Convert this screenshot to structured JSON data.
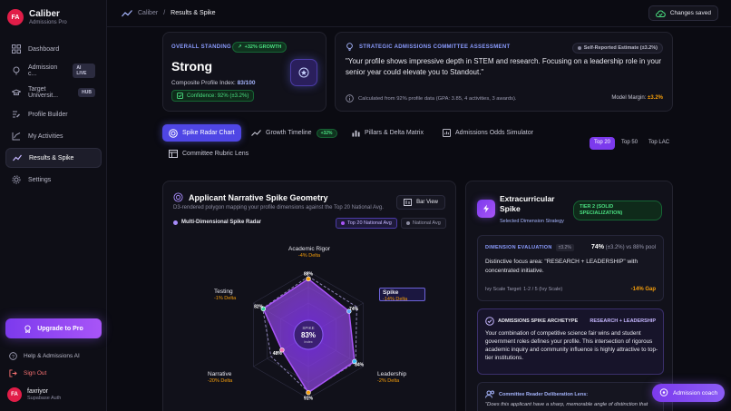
{
  "brand": {
    "initials": "FA",
    "name": "Caliber",
    "sub": "Admissions Pro"
  },
  "nav": [
    {
      "label": "Dashboard",
      "icon": "grid-icon",
      "active": false,
      "badge": ""
    },
    {
      "label": "Admission c...",
      "icon": "pin-icon",
      "active": false,
      "badge": "AI LIVE"
    },
    {
      "label": "Target Universit...",
      "icon": "graduation-cap-icon",
      "active": false,
      "badge": "HUB"
    },
    {
      "label": "Profile Builder",
      "icon": "edit-icon",
      "active": false,
      "badge": ""
    },
    {
      "label": "My Activities",
      "icon": "activity-icon",
      "active": false,
      "badge": ""
    },
    {
      "label": "Results & Spike",
      "icon": "trend-icon",
      "active": true,
      "badge": ""
    },
    {
      "label": "Settings",
      "icon": "gear-icon",
      "active": false,
      "badge": ""
    }
  ],
  "upgrade": "Upgrade to Pro",
  "help": "Help & Admissions AI",
  "signout": "Sign Out",
  "user": {
    "initials": "FA",
    "name": "faxriyor",
    "sub": "Supabase Auth"
  },
  "topbar": {
    "root": "Caliber",
    "sep": "/",
    "current": "Results & Spike",
    "saved": "Changes saved"
  },
  "standing": {
    "label": "OVERALL STANDING",
    "growth": "+32% GROWTH",
    "value": "Strong",
    "index_label": "Composite Profile Index:",
    "index_value": "83/100",
    "confidence": "Confidence: 92% (±3.2%)"
  },
  "committee": {
    "label": "STRATEGIC ADMISSIONS COMMITTEE ASSESSMENT",
    "badge": "Self-Reported Estimate (±3.2%)",
    "quote": "\"Your profile shows impressive depth in STEM and research. Focusing on a leadership role in your senior year could elevate you to Standout.\"",
    "calc": "Calculated from 92% profile data (GPA: 3.85, 4 activities, 3 awards).",
    "margin_label": "Model Margin:",
    "margin_value": "±3.2%"
  },
  "tabs": [
    {
      "label": "Spike Radar Chart",
      "icon": "radar-icon",
      "active": true,
      "badge": ""
    },
    {
      "label": "Growth Timeline",
      "icon": "trend-icon",
      "active": false,
      "badge": "+32%"
    },
    {
      "label": "Pillars & Delta Matrix",
      "icon": "bars-icon",
      "active": false,
      "badge": ""
    },
    {
      "label": "Admissions Odds Simulator",
      "icon": "chart-icon",
      "active": false,
      "badge": ""
    },
    {
      "label": "Committee Rubric Lens",
      "icon": "table-icon",
      "active": false,
      "badge": ""
    }
  ],
  "segments": [
    "Top 20",
    "Top 50",
    "Top LAC"
  ],
  "radar": {
    "title": "Applicant Narrative Spike Geometry",
    "subtitle": "D3-rendered polygon mapping your profile dimensions against the Top 20 National Avg.",
    "bar_view": "Bar View",
    "multi": "Multi-Dimensional Spike Radar",
    "legend_you": "Top 20 National Avg",
    "legend_avg": "National Avg",
    "center_label": "SPIKE",
    "center_value": "83%",
    "center_sub": "Index"
  },
  "chart_data": {
    "type": "radar",
    "axes": [
      "Academic Rigor",
      "Spike",
      "Leadership",
      "Community",
      "Narrative",
      "Testing"
    ],
    "values": [
      88,
      74,
      84,
      91,
      48,
      82
    ],
    "value_labels": [
      "88%",
      "74%",
      "84%",
      "91%",
      "48%",
      "82%"
    ],
    "deltas": [
      "-4% Delta",
      "-14% Delta",
      "-2% Delta",
      "",
      "-20% Delta",
      "-1% Delta"
    ],
    "benchmark": [
      92,
      88,
      86,
      90,
      68,
      83
    ],
    "range": [
      0,
      100
    ],
    "colors": {
      "you": "#a855f7",
      "benchmark": "#8b8ba0",
      "accent": "#f59e0b"
    }
  },
  "extra": {
    "title": "Extracurricular Spike",
    "tier": "TIER 2 (SOLID SPECIALIZATION)",
    "sub": "Selected Dimension Strategy",
    "eval_label": "DIMENSION EVALUATION",
    "eval_tag": "±3.2%",
    "eval_value": "74%",
    "eval_rest": "(±3.2%) vs 88% pool",
    "focus": "Distinctive focus area: \"RESEARCH + LEADERSHIP\" with concentrated initiative.",
    "ivy": "Ivy Scale Target: 1-2 / 5 (Ivy Scale)",
    "gap": "-14% Gap",
    "arch_label": "ADMISSIONS SPIKE ARCHETYPE",
    "arch_value": "RESEARCH + LEADERSHIP",
    "arch_text": "Your combination of competitive science fair wins and student government roles defines your profile. This intersection of rigorous academic inquiry and community influence is highly attractive to top-tier institutions.",
    "lens_label": "Committee Reader Deliberation Lens:",
    "lens_text": "\"Does this applicant have a sharp, memorable angle of distinction that"
  },
  "coach": "Admission coach"
}
